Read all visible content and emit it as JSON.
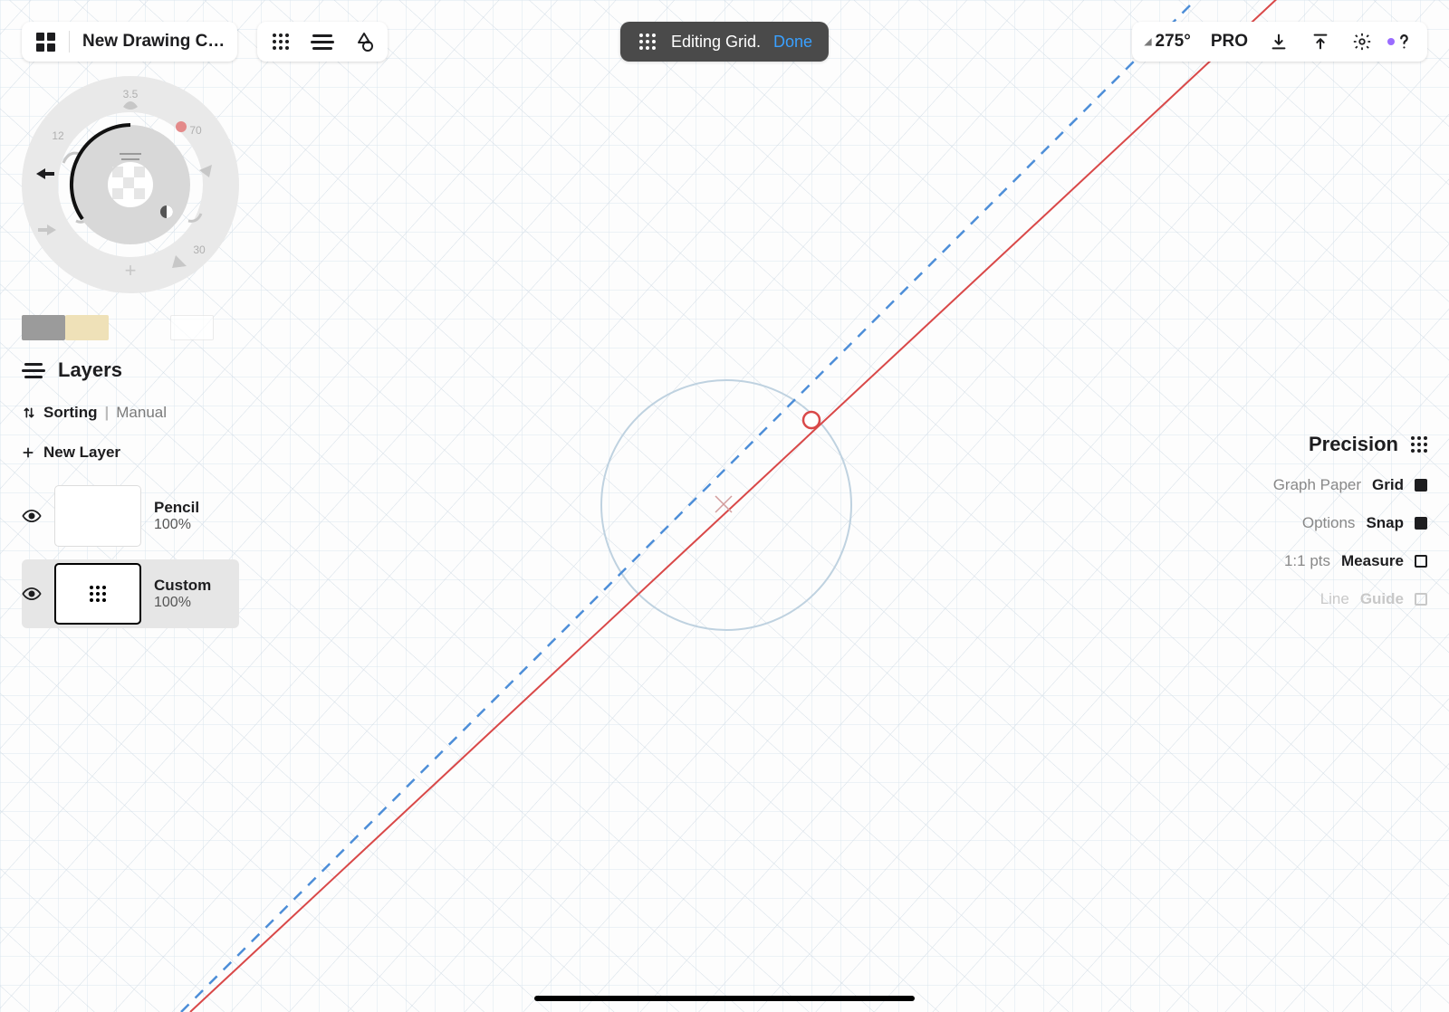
{
  "header": {
    "title": "New Drawing C…"
  },
  "status": {
    "text": "Editing Grid.",
    "done_label": "Done"
  },
  "angleReadout": "275°",
  "proLabel": "PRO",
  "radial": {
    "values": {
      "t1": "3.5",
      "t2": "12",
      "t3": "70",
      "t4": "30"
    }
  },
  "layersPanel": {
    "title": "Layers",
    "sortLabel": "Sorting",
    "sortMode": "Manual",
    "newLayerLabel": "New Layer"
  },
  "layers": [
    {
      "name": "Pencil",
      "opacity": "100%",
      "selected": false
    },
    {
      "name": "Custom",
      "opacity": "100%",
      "selected": true
    }
  ],
  "precision": {
    "title": "Precision",
    "rows": {
      "gridK": "Graph Paper",
      "gridV": "Grid",
      "snapK": "Options",
      "snapV": "Snap",
      "measK": "1:1 pts",
      "measV": "Measure",
      "guideK": "Line",
      "guideV": "Guide"
    }
  }
}
